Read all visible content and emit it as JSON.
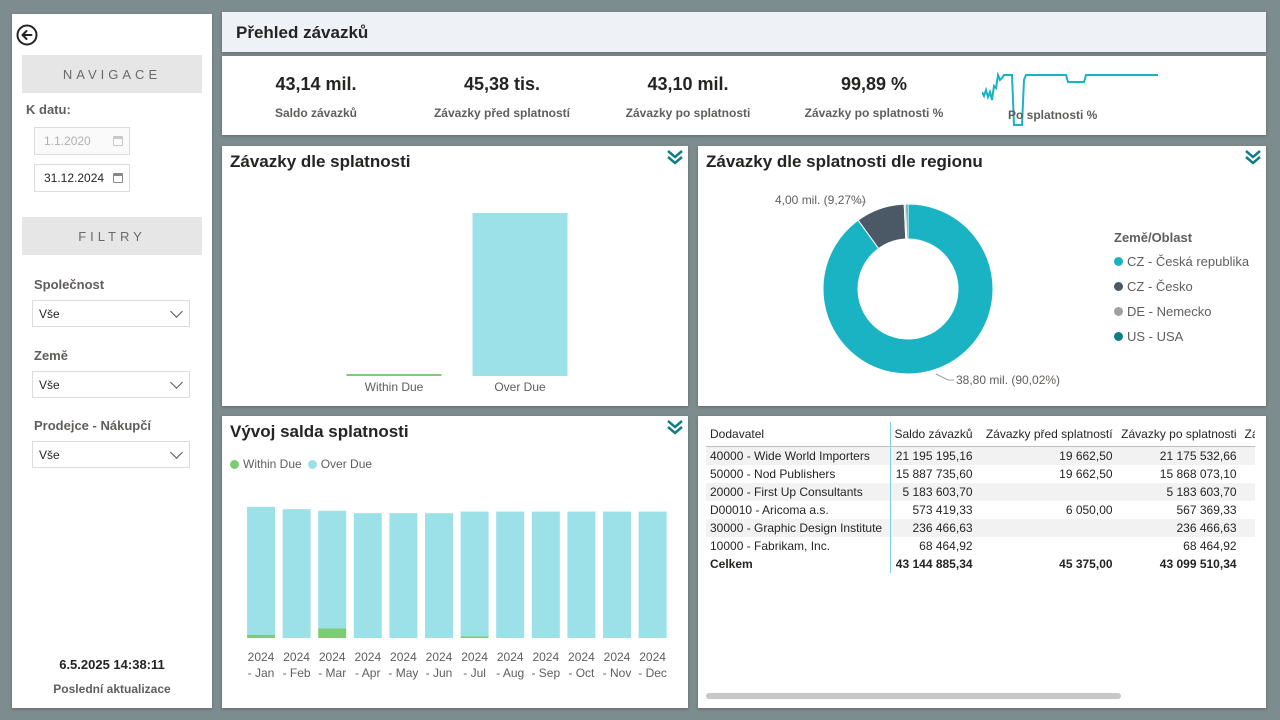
{
  "page": {
    "title": "Přehled závazků"
  },
  "sidebar": {
    "navigation_header": "NAVIGACE",
    "date_label": "K datu:",
    "date_from": "1.1.2020",
    "date_to": "31.12.2024",
    "filters_header": "FILTRY",
    "filters": [
      {
        "label": "Společnost",
        "value": "Vše"
      },
      {
        "label": "Země",
        "value": "Vše"
      },
      {
        "label": "Prodejce - Nákupčí",
        "value": "Vše"
      }
    ],
    "refresh_time": "6.5.2025 14:38:11",
    "refresh_label": "Poslední aktualizace"
  },
  "kpis": [
    {
      "value": "43,14 mil.",
      "label": "Saldo závazků"
    },
    {
      "value": "45,38 tis.",
      "label": "Závazky před splatností"
    },
    {
      "value": "43,10 mil.",
      "label": "Závazky po splatnosti"
    },
    {
      "value": "99,89 %",
      "label": "Závazky po splatnosti %"
    }
  ],
  "sparkline": {
    "label": "Po splatnosti %",
    "color": "#1ab3c4"
  },
  "colors": {
    "teal": "#1ab3c4",
    "light_teal": "#9de1e8",
    "green": "#7dcb74",
    "slate": "#4b5866",
    "dark_teal": "#117e87",
    "grey": "#a0a0a0"
  },
  "chart_due": {
    "title": "Závazky dle splatnosti",
    "chart_data": {
      "type": "bar",
      "categories": [
        "Within Due",
        "Over Due"
      ],
      "values": [
        45375,
        43099510
      ]
    }
  },
  "chart_region": {
    "title": "Závazky dle splatnosti dle regionu",
    "legend_title": "Země/Oblast",
    "legend": [
      {
        "name": "CZ - Česká republika",
        "color": "#1ab3c4"
      },
      {
        "name": "CZ - Česko",
        "color": "#4b5866"
      },
      {
        "name": "DE - Nemecko",
        "color": "#a0a0a0"
      },
      {
        "name": "US - USA",
        "color": "#117e87"
      }
    ],
    "label_small": "4,00 mil. (9,27%)",
    "label_large": "38,80 mil. (90,02%)",
    "chart_data": {
      "type": "pie",
      "categories": [
        "CZ - Česká republika",
        "CZ - Česko",
        "DE - Nemecko",
        "US - USA"
      ],
      "values": [
        90.02,
        9.27,
        0.3,
        0.41
      ]
    }
  },
  "chart_trend": {
    "title": "Vývoj salda splatnosti",
    "legend": [
      {
        "name": "Within Due",
        "color": "#7dcb74"
      },
      {
        "name": "Over Due",
        "color": "#9de1e8"
      }
    ],
    "chart_data": {
      "type": "bar",
      "stacked": true,
      "categories": [
        "2024 - Jan",
        "2024 - Feb",
        "2024 - Mar",
        "2024 - Apr",
        "2024 - May",
        "2024 - Jun",
        "2024 - Jul",
        "2024 - Aug",
        "2024 - Sep",
        "2024 - Oct",
        "2024 - Nov",
        "2024 - Dec"
      ],
      "series": [
        {
          "name": "Within Due",
          "values": [
            0.4,
            0,
            1.2,
            0,
            0,
            0,
            0.2,
            0,
            0,
            0,
            0,
            0
          ]
        },
        {
          "name": "Over Due",
          "values": [
            16.1,
            16.2,
            14.8,
            15.7,
            15.7,
            15.7,
            15.7,
            15.9,
            15.9,
            15.9,
            15.9,
            15.9
          ]
        }
      ],
      "categories_line1": [
        "2024",
        "2024",
        "2024",
        "2024",
        "2024",
        "2024",
        "2024",
        "2024",
        "2024",
        "2024",
        "2024",
        "2024"
      ],
      "categories_line2": [
        "- Jan",
        "- Feb",
        "- Mar",
        "- Apr",
        "- May",
        "- Jun",
        "- Jul",
        "- Aug",
        "- Sep",
        "- Oct",
        "- Nov",
        "- Dec"
      ]
    }
  },
  "table": {
    "headers": [
      "Dodavatel",
      "Saldo závazků",
      "Závazky před splatností",
      "Závazky po splatnosti",
      "Zá"
    ],
    "rows": [
      [
        "40000 - Wide World Importers",
        "21 195 195,16",
        "19 662,50",
        "21 175 532,66"
      ],
      [
        "50000 - Nod Publishers",
        "15 887 735,60",
        "19 662,50",
        "15 868 073,10"
      ],
      [
        "20000 - First Up Consultants",
        "5 183 603,70",
        "",
        "5 183 603,70"
      ],
      [
        "D00010 - Aricoma a.s.",
        "573 419,33",
        "6 050,00",
        "567 369,33"
      ],
      [
        "30000 - Graphic Design Institute",
        "236 466,63",
        "",
        "236 466,63"
      ],
      [
        "10000 - Fabrikam, Inc.",
        "68 464,92",
        "",
        "68 464,92"
      ]
    ],
    "total": [
      "Celkem",
      "43 144 885,34",
      "45 375,00",
      "43 099 510,34"
    ]
  }
}
